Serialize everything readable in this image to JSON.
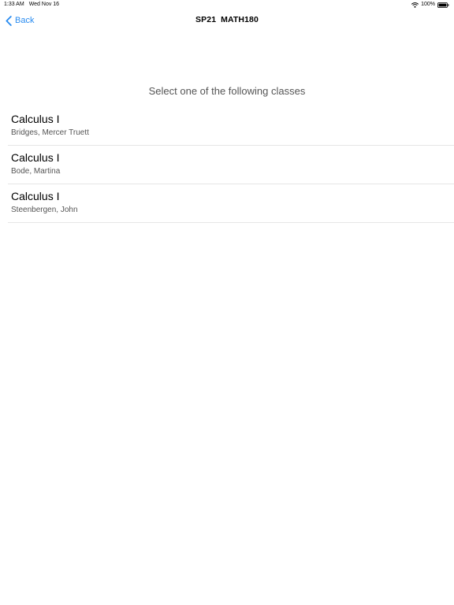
{
  "status_bar": {
    "time": "1:33 AM",
    "date": "Wed Nov 16",
    "battery": "100%",
    "wifi_icon": "wifi-icon",
    "battery_icon": "battery-icon"
  },
  "nav": {
    "back_label": "Back",
    "back_icon": "chevron-left-icon",
    "title": "SP21  MATH180",
    "accent_color": "#2a8cf0"
  },
  "prompt": "Select one of the following classes",
  "classes": [
    {
      "name": "Calculus I",
      "instructor": "Bridges, Mercer Truett"
    },
    {
      "name": "Calculus I",
      "instructor": "Bode, Martina"
    },
    {
      "name": "Calculus I",
      "instructor": "Steenbergen, John"
    }
  ]
}
